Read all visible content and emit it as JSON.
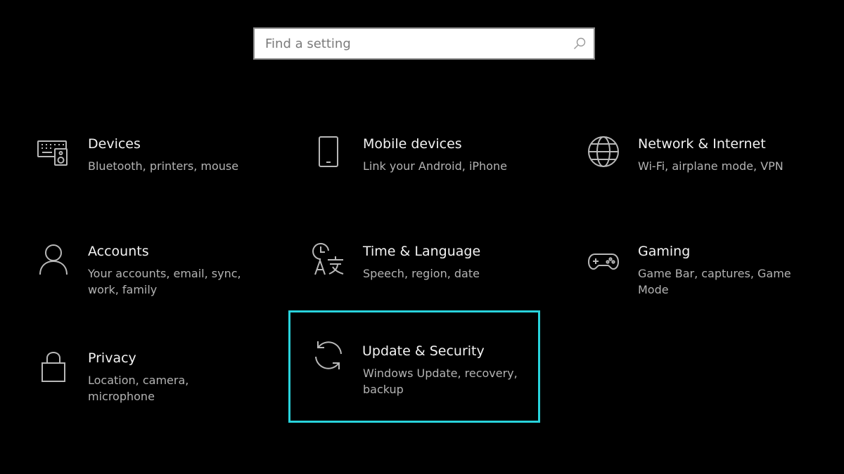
{
  "search": {
    "placeholder": "Find a setting",
    "value": "",
    "icon": "search-icon"
  },
  "tiles": [
    {
      "title": "Devices",
      "description": "Bluetooth, printers, mouse",
      "icon": "devices-icon"
    },
    {
      "title": "Mobile devices",
      "description": "Link your Android, iPhone",
      "icon": "phone-icon"
    },
    {
      "title": "Network & Internet",
      "description": "Wi-Fi, airplane mode, VPN",
      "icon": "globe-icon"
    },
    {
      "title": "Accounts",
      "description": "Your accounts, email, sync, work, family",
      "icon": "person-icon"
    },
    {
      "title": "Time & Language",
      "description": "Speech, region, date",
      "icon": "time-language-icon"
    },
    {
      "title": "Gaming",
      "description": "Game Bar, captures, Game Mode",
      "icon": "gamepad-icon"
    },
    {
      "title": "Privacy",
      "description": "Location, camera, microphone",
      "icon": "lock-icon"
    },
    {
      "title": "Update & Security",
      "description": "Windows Update, recovery, backup",
      "icon": "sync-icon",
      "selected": true
    }
  ],
  "colors": {
    "background": "#000000",
    "selection_border": "#29d3dc",
    "title_text": "#f2f2f2",
    "description_text": "#b3b3b3",
    "icon": "#b8b8b8"
  }
}
